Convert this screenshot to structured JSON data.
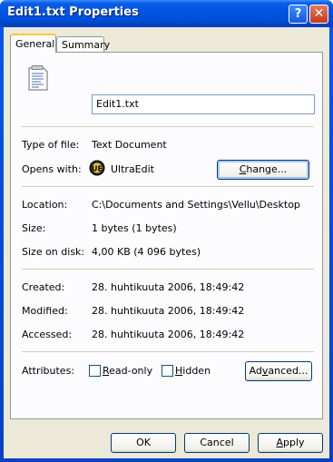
{
  "window": {
    "title": "Edit1.txt Properties"
  },
  "titlebar": {
    "help": "?",
    "close": "✕"
  },
  "tabs": [
    {
      "label": "General"
    },
    {
      "label": "Summary"
    }
  ],
  "general": {
    "filename": "Edit1.txt",
    "type_label": "Type of file:",
    "type_value": "Text Document",
    "opens_label": "Opens with:",
    "opens_value": "UltraEdit",
    "change_prefix": "C",
    "change_rest": "hange...",
    "location_label": "Location:",
    "location_value": "C:\\Documents and Settings\\Vellu\\Desktop",
    "size_label": "Size:",
    "size_value": "1 bytes (1 bytes)",
    "size_disk_label": "Size on disk:",
    "size_disk_value": "4,00 KB (4 096 bytes)",
    "created_label": "Created:",
    "created_value": "28. huhtikuuta 2006, 18:49:42",
    "modified_label": "Modified:",
    "modified_value": "28. huhtikuuta 2006, 18:49:42",
    "accessed_label": "Accessed:",
    "accessed_value": "28. huhtikuuta 2006, 18:49:42",
    "attributes_label": "Attributes:",
    "readonly_prefix": "R",
    "readonly_rest": "ead-only",
    "hidden_prefix": "H",
    "hidden_rest": "idden",
    "advanced_prefix": "Ad",
    "advanced_u": "v",
    "advanced_rest": "anced..."
  },
  "footer": {
    "ok": "OK",
    "cancel": "Cancel",
    "apply_u": "A",
    "apply_rest": "pply"
  }
}
